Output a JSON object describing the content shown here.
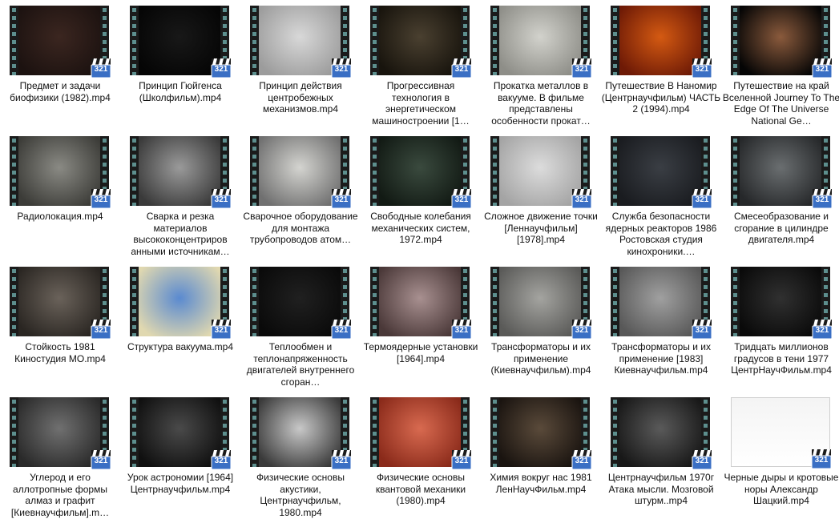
{
  "files": [
    {
      "label": "Предмет и задачи биофизики (1982).mp4",
      "tone": [
        "#3b2620",
        "#1c1210"
      ],
      "plain": false
    },
    {
      "label": "Принцип Гюйгенса (Школфильм).mp4",
      "tone": [
        "#181818",
        "#050505"
      ],
      "plain": false
    },
    {
      "label": "Принцип действия центробежных механизмов.mp4",
      "tone": [
        "#d8d8d8",
        "#9c9c9c"
      ],
      "plain": false
    },
    {
      "label": "Прогрессивная технология в энергетическом машиностроении [1…",
      "tone": [
        "#4a4030",
        "#18140d"
      ],
      "plain": false
    },
    {
      "label": "Прокатка металлов в вакууме. В фильме представлены особенности прокат…",
      "tone": [
        "#d2d2cc",
        "#8e8e88"
      ],
      "plain": false
    },
    {
      "label": "Путешествие В Наномир (Центрнаучфильм) ЧАСТЬ 2 (1994).mp4",
      "tone": [
        "#d45a12",
        "#6e1a06"
      ],
      "plain": false
    },
    {
      "label": "Путешествие на край Вселенной Journey To The Edge Of The Universe National Ge…",
      "tone": [
        "#8a5a3c",
        "#050505"
      ],
      "plain": false
    },
    {
      "label": "Радиолокация.mp4",
      "tone": [
        "#8a8a84",
        "#3c3c38"
      ],
      "plain": false
    },
    {
      "label": "Сварка и резка материалов высококонцентриров анными источникам…",
      "tone": [
        "#9a9a9a",
        "#3a3a3a"
      ],
      "plain": false
    },
    {
      "label": "Сварочное оборудование для монтажа трубопроводов атом…",
      "tone": [
        "#d4d4d0",
        "#707070"
      ],
      "plain": false
    },
    {
      "label": "Свободные колебания механических систем, 1972.mp4",
      "tone": [
        "#3a4a3e",
        "#121a14"
      ],
      "plain": false
    },
    {
      "label": "Сложное движение точки [Леннаучфильм] [1978].mp4",
      "tone": [
        "#dcdcdc",
        "#a4a4a4"
      ],
      "plain": false
    },
    {
      "label": "Служба безопасности ядерных реакторов 1986 Ростовская студия кинохроники.…",
      "tone": [
        "#3a3e44",
        "#1a1c20"
      ],
      "plain": false
    },
    {
      "label": "Смесеобразование и сгорание в цилиндре двигателя.mp4",
      "tone": [
        "#6a6e70",
        "#26282a"
      ],
      "plain": false
    },
    {
      "label": "Стойкость 1981 Киностудия МО.mp4",
      "tone": [
        "#6a625a",
        "#2a2622"
      ],
      "plain": false
    },
    {
      "label": "Структура вакуума.mp4",
      "tone": [
        "#5a8ad0",
        "#e0d8b0"
      ],
      "plain": false
    },
    {
      "label": "Теплообмен и теплонапряженность двигателей внутреннего сгоран…",
      "tone": [
        "#202020",
        "#0a0a0a"
      ],
      "plain": false
    },
    {
      "label": "Термоядерные установки [1964].mp4",
      "tone": [
        "#a89090",
        "#4a3838"
      ],
      "plain": false
    },
    {
      "label": "Трансформаторы и их применение (Киевнаучфильм).mp4",
      "tone": [
        "#a4a4a0",
        "#5a5a58"
      ],
      "plain": false
    },
    {
      "label": "Трансформаторы и их применение [1983] Киевнаучфильм.mp4",
      "tone": [
        "#a0a0a0",
        "#585858"
      ],
      "plain": false
    },
    {
      "label": "Тридцать миллионов градусов в тени 1977 ЦентрНаучФильм.mp4",
      "tone": [
        "#303030",
        "#0a0a0a"
      ],
      "plain": false
    },
    {
      "label": "Углерод и его аллотропные формы алмаз и графит [Киевнаучфильм].m…",
      "tone": [
        "#707070",
        "#2a2a2a"
      ],
      "plain": false
    },
    {
      "label": "Урок астрономии [1964] Центрнаучфильм.mp4",
      "tone": [
        "#4a4a4a",
        "#101010"
      ],
      "plain": false
    },
    {
      "label": "Физические основы акустики, Центрнаучфильм, 1980.mp4",
      "tone": [
        "#c8c8c8",
        "#3a3a3a"
      ],
      "plain": false
    },
    {
      "label": "Физические основы квантовой механики (1980).mp4",
      "tone": [
        "#d86a50",
        "#8a2a1a"
      ],
      "plain": false
    },
    {
      "label": "Химия вокруг нас 1981 ЛенНаучФильм.mp4",
      "tone": [
        "#5a4a3a",
        "#1a1410"
      ],
      "plain": false
    },
    {
      "label": "Центрнаучфильм 1970г Атака мысли. Мозговой штурм..mp4",
      "tone": [
        "#5a5a5a",
        "#181818"
      ],
      "plain": false
    },
    {
      "label": "Черные дыры и кротовые норы Александр Шацкий.mp4",
      "tone": [
        "#f4f4f4",
        "#ffffff"
      ],
      "plain": true
    }
  ],
  "badge": {
    "text": "321",
    "colors": {
      "clapper": "#1a1a1a",
      "stripe": "#ffffff",
      "tile": "#3a6fc4",
      "text": "#ffffff"
    }
  }
}
